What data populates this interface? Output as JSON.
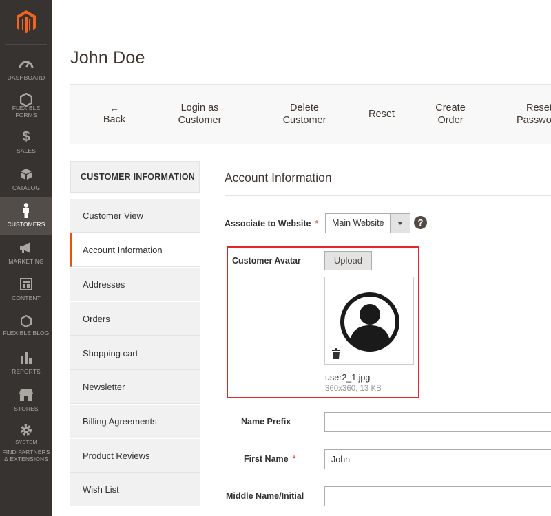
{
  "menu": {
    "logo": "magento-logo",
    "items": [
      {
        "label": "DASHBOARD",
        "icon": "dashboard-icon"
      },
      {
        "label": "FLEXIBLE FORMS",
        "icon": "hexagon-icon"
      },
      {
        "label": "SALES",
        "icon": "dollar-icon"
      },
      {
        "label": "CATALOG",
        "icon": "box-icon"
      },
      {
        "label": "CUSTOMERS",
        "icon": "person-icon"
      },
      {
        "label": "MARKETING",
        "icon": "megaphone-icon"
      },
      {
        "label": "CONTENT",
        "icon": "layout-icon"
      },
      {
        "label": "FLEXIBLE BLOG",
        "icon": "hexagon-icon"
      },
      {
        "label": "REPORTS",
        "icon": "bar-chart-icon"
      },
      {
        "label": "STORES",
        "icon": "store-icon"
      },
      {
        "label": "SYSTEM",
        "icon": "gear-icon"
      },
      {
        "label": "FIND PARTNERS & EXTENSIONS",
        "icon": "puzzle-icon"
      }
    ],
    "active": "CUSTOMERS"
  },
  "page": {
    "title": "John Doe"
  },
  "toolbar": {
    "back": "Back",
    "back_arrow": "←",
    "login_as_customer": [
      "Login as",
      "Customer"
    ],
    "delete_customer": [
      "Delete",
      "Customer"
    ],
    "reset": "Reset",
    "create_order": [
      "Create",
      "Order"
    ],
    "reset_password": [
      "Reset",
      "Password"
    ]
  },
  "tabs": {
    "title": "CUSTOMER INFORMATION",
    "items": [
      "Customer View",
      "Account Information",
      "Addresses",
      "Orders",
      "Shopping cart",
      "Newsletter",
      "Billing Agreements",
      "Product Reviews",
      "Wish List"
    ],
    "active": "Account Information"
  },
  "form": {
    "section_title": "Account Information",
    "associate_label": "Associate to Website",
    "associate_value": "Main Website",
    "help": "?",
    "required_mark": "*",
    "avatar_label": "Customer Avatar",
    "upload_label": "Upload",
    "file_name": "user2_1.jpg",
    "file_meta": "360x360, 13 KB",
    "name_prefix_label": "Name Prefix",
    "name_prefix_value": "",
    "first_name_label": "First Name",
    "first_name_value": "John",
    "middle_name_label": "Middle Name/Initial",
    "middle_name_value": ""
  },
  "colors": {
    "sidebar": "#373330",
    "accent": "#eb5202",
    "highlight_border": "#e4262b",
    "required": "#e22626"
  }
}
